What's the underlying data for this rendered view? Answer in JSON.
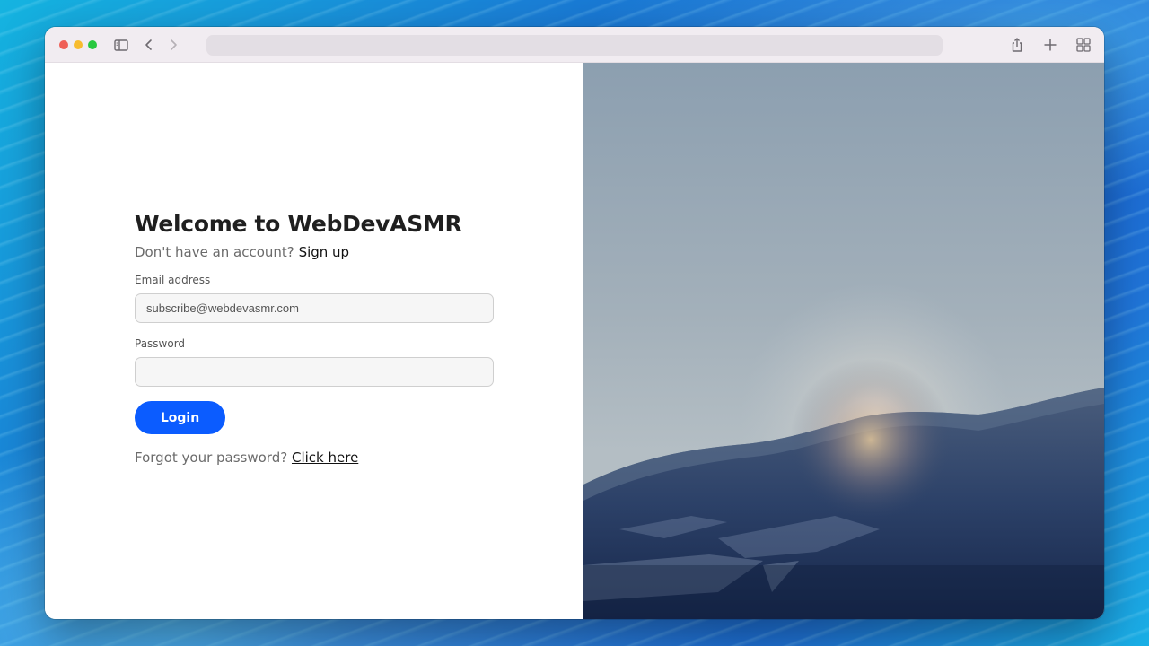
{
  "browser": {
    "address": ""
  },
  "form": {
    "title": "Welcome to WebDevASMR",
    "signup_prompt": "Don't have an account?",
    "signup_link": "Sign up",
    "email_label": "Email address",
    "email_value": "subscribe@webdevasmr.com",
    "password_label": "Password",
    "password_value": "",
    "login_label": "Login",
    "forgot_prompt": "Forgot your password?",
    "forgot_link": "Click here"
  },
  "colors": {
    "accent": "#0b5cff",
    "title": "#1f1f1f",
    "muted": "#6b6b6b"
  },
  "icons": [
    "sidebar-icon",
    "back-icon",
    "forward-icon",
    "share-icon",
    "new-tab-icon",
    "tab-overview-icon"
  ]
}
